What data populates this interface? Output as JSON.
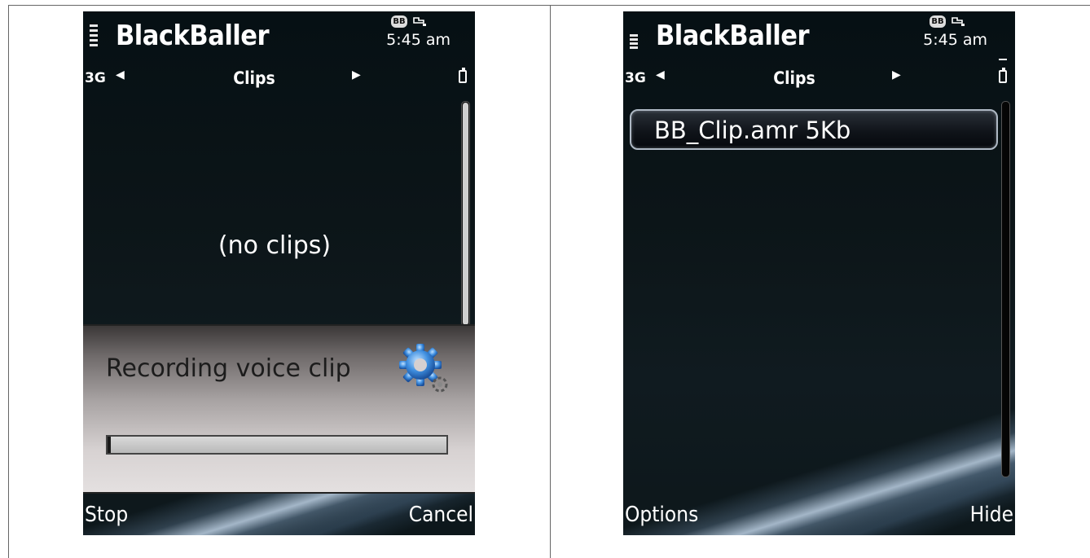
{
  "left_screen": {
    "app_title": "BlackBaller",
    "clock": "5:45 am",
    "badge": "BB",
    "network": "3G",
    "tab_title": "Clips",
    "empty_message": "(no clips)",
    "dialog": {
      "message": "Recording voice clip",
      "progress": 0.01
    },
    "softkeys": {
      "left": "Stop",
      "right": "Cancel"
    }
  },
  "right_screen": {
    "app_title": "BlackBaller",
    "clock": "5:45 am",
    "badge": "BB",
    "network": "3G",
    "tab_title": "Clips",
    "clips": [
      {
        "label": "BB_Clip.amr 5Kb"
      }
    ],
    "softkeys": {
      "left": "Options",
      "right": "Hide"
    }
  },
  "icons": {
    "tab_prev": "arrow-left-icon",
    "tab_next": "arrow-right-icon",
    "signal": "signal-icon",
    "battery": "battery-icon",
    "usb": "usb-icon",
    "busy": "gear-icon"
  }
}
